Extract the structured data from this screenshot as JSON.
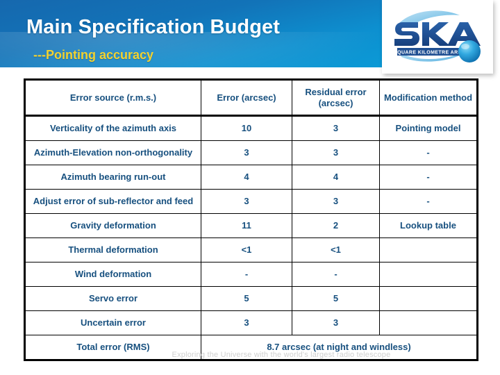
{
  "slide": {
    "title": "Main Specification Budget",
    "subtitle": "---Pointing accuracy",
    "footer_tagline": "Exploring the Universe with the world's largest radio telescope",
    "accent_blue": "#1273b8",
    "subtitle_yellow": "#f2d230",
    "table_text_blue": "#17507f",
    "total_red": "#e03a17"
  },
  "logo": {
    "name": "ska-logo",
    "wordmark": "SKA",
    "tagline": "SQUARE KILOMETRE ARRAY"
  },
  "table": {
    "headers": [
      "Error source (r.m.s.)",
      "Error (arcsec)",
      "Residual error (arcsec)",
      "Modification method"
    ],
    "rows": [
      {
        "source": "Verticality of the azimuth axis",
        "error": "10",
        "residual": "3",
        "method": "Pointing model"
      },
      {
        "source": "Azimuth-Elevation non-orthogonality",
        "error": "3",
        "residual": "3",
        "method": "-"
      },
      {
        "source": "Azimuth bearing run-out",
        "error": "4",
        "residual": "4",
        "method": "-"
      },
      {
        "source": "Adjust error of sub-reflector and feed",
        "error": "3",
        "residual": "3",
        "method": "-"
      },
      {
        "source": "Gravity deformation",
        "error": "11",
        "residual": "2",
        "method": "Lookup table"
      },
      {
        "source": "Thermal deformation",
        "error": "<1",
        "residual": "<1",
        "method": ""
      },
      {
        "source": "Wind deformation",
        "error": "-",
        "residual": "-",
        "method": ""
      },
      {
        "source": "Servo error",
        "error": "5",
        "residual": "5",
        "method": ""
      },
      {
        "source": "Uncertain error",
        "error": "3",
        "residual": "3",
        "method": ""
      }
    ],
    "total": {
      "label": "Total error (RMS)",
      "value": "8.7 arcsec (at night and windless)"
    }
  }
}
